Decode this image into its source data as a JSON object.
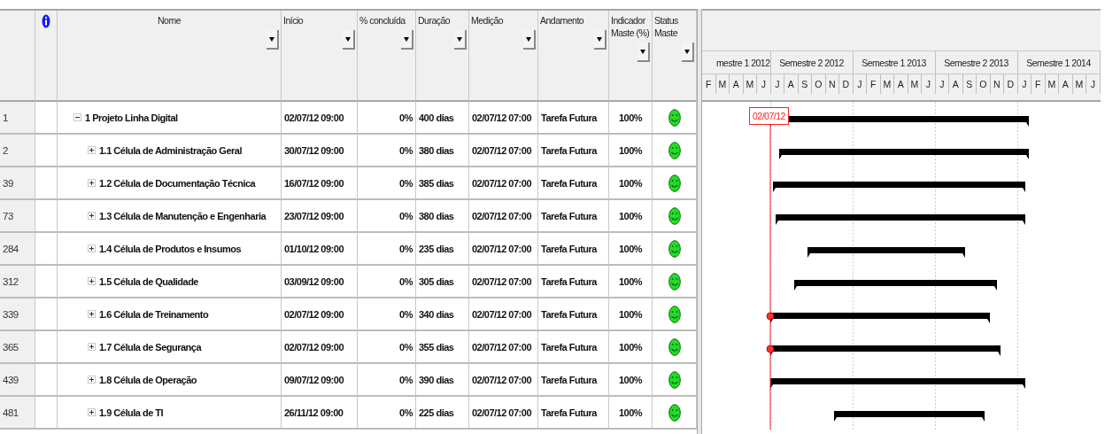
{
  "table": {
    "columns": [
      {
        "kind": "id"
      },
      {
        "kind": "info"
      },
      {
        "kind": "centered",
        "label": "Nome"
      },
      {
        "kind": "text",
        "label": "Início"
      },
      {
        "kind": "text",
        "label": "% concluída"
      },
      {
        "kind": "text",
        "label": "Duração"
      },
      {
        "kind": "text",
        "label": "Medição"
      },
      {
        "kind": "text",
        "label": "Andamento"
      },
      {
        "kind": "text",
        "label": "Indicador Maste (%)"
      },
      {
        "kind": "text",
        "label": "Status Maste"
      }
    ],
    "rows": [
      {
        "id": "1",
        "name": "1 Projeto Linha Digital",
        "expanded": true,
        "start": "02/07/12 09:00",
        "percent": "0%",
        "duration": "400 dias",
        "measurement": "02/07/12 07:00",
        "progress": "Tarefa Futura",
        "indicator": "100%",
        "children": [
          {
            "id": "2",
            "name": "1.1 Célula de Administração Geral",
            "expanded": false,
            "start": "30/07/12 09:00",
            "percent": "0%",
            "duration": "380 dias",
            "measurement": "02/07/12 07:00",
            "progress": "Tarefa Futura",
            "indicator": "100%"
          },
          {
            "id": "39",
            "name": "1.2 Célula de Documentação Técnica",
            "expanded": false,
            "start": "16/07/12 09:00",
            "percent": "0%",
            "duration": "385 dias",
            "measurement": "02/07/12 07:00",
            "progress": "Tarefa Futura",
            "indicator": "100%"
          },
          {
            "id": "73",
            "name": "1.3 Célula de Manutenção e Engenharia",
            "expanded": false,
            "start": "23/07/12 09:00",
            "percent": "0%",
            "duration": "380 dias",
            "measurement": "02/07/12 07:00",
            "progress": "Tarefa Futura",
            "indicator": "100%"
          },
          {
            "id": "284",
            "name": "1.4 Célula de Produtos e Insumos",
            "expanded": false,
            "start": "01/10/12 09:00",
            "percent": "0%",
            "duration": "235 dias",
            "measurement": "02/07/12 07:00",
            "progress": "Tarefa Futura",
            "indicator": "100%"
          },
          {
            "id": "312",
            "name": "1.5 Célula de Qualidade",
            "expanded": false,
            "start": "03/09/12 09:00",
            "percent": "0%",
            "duration": "305 dias",
            "measurement": "02/07/12 07:00",
            "progress": "Tarefa Futura",
            "indicator": "100%"
          },
          {
            "id": "339",
            "name": "1.6 Célula de Treinamento",
            "expanded": false,
            "start": "02/07/12 09:00",
            "percent": "0%",
            "duration": "340 dias",
            "measurement": "02/07/12 07:00",
            "progress": "Tarefa Futura",
            "indicator": "100%"
          },
          {
            "id": "365",
            "name": "1.7 Célula de Segurança",
            "expanded": false,
            "start": "02/07/12 09:00",
            "percent": "0%",
            "duration": "355 dias",
            "measurement": "02/07/12 07:00",
            "progress": "Tarefa Futura",
            "indicator": "100%"
          },
          {
            "id": "439",
            "name": "1.8 Célula de Operação",
            "expanded": false,
            "start": "09/07/12 09:00",
            "percent": "0%",
            "duration": "390 dias",
            "measurement": "02/07/12 07:00",
            "progress": "Tarefa Futura",
            "indicator": "100%"
          },
          {
            "id": "481",
            "name": "1.9 Célula de TI",
            "expanded": false,
            "start": "26/11/12 09:00",
            "percent": "0%",
            "duration": "225 dias",
            "measurement": "02/07/12 07:00",
            "progress": "Tarefa Futura",
            "indicator": "100%"
          }
        ]
      }
    ]
  },
  "gantt": {
    "semesters": [
      {
        "label": "mestre 1 2012",
        "months": [
          "F",
          "M",
          "A",
          "M",
          "J"
        ]
      },
      {
        "label": "Semestre 2 2012",
        "months": [
          "J",
          "A",
          "S",
          "O",
          "N",
          "D"
        ]
      },
      {
        "label": "Semestre 1 2013",
        "months": [
          "J",
          "F",
          "M",
          "A",
          "M",
          "J"
        ]
      },
      {
        "label": "Semestre 2 2013",
        "months": [
          "J",
          "A",
          "S",
          "O",
          "N",
          "D"
        ]
      },
      {
        "label": "Semestre 1 2014",
        "months": [
          "J",
          "F",
          "M",
          "A",
          "M",
          "J"
        ]
      }
    ],
    "today_label": "02/07/12"
  }
}
